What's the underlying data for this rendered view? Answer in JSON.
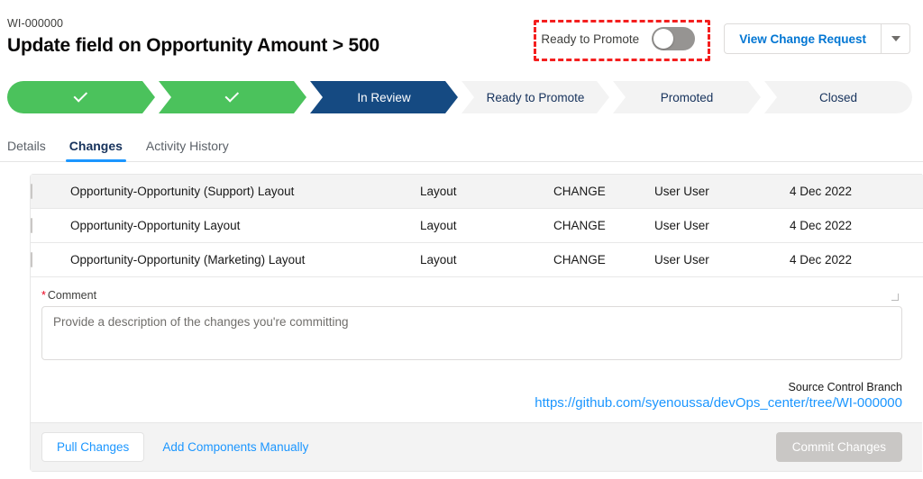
{
  "header": {
    "record_id": "WI-000000",
    "title": "Update field on Opportunity Amount > 500",
    "toggle_label": "Ready to Promote",
    "toggle_state": "off",
    "view_change_request_label": "View Change Request",
    "annotation_color": "#f41f1f"
  },
  "path": {
    "steps": [
      {
        "label": "",
        "state": "done"
      },
      {
        "label": "",
        "state": "done"
      },
      {
        "label": "In Review",
        "state": "current"
      },
      {
        "label": "Ready to Promote",
        "state": "upcoming"
      },
      {
        "label": "Promoted",
        "state": "upcoming"
      },
      {
        "label": "Closed",
        "state": "upcoming"
      }
    ],
    "done_color": "#4bc25c",
    "current_color": "#154a82",
    "upcoming_color": "#f3f3f3"
  },
  "tabs": [
    {
      "label": "Details",
      "active": false
    },
    {
      "label": "Changes",
      "active": true
    },
    {
      "label": "Activity History",
      "active": false
    }
  ],
  "table": {
    "rows": [
      {
        "name": "Opportunity-Opportunity (Support) Layout",
        "type": "Layout",
        "operation": "CHANGE",
        "user": "User User",
        "date": "4 Dec 2022",
        "checked": false,
        "selected": true
      },
      {
        "name": "Opportunity-Opportunity Layout",
        "type": "Layout",
        "operation": "CHANGE",
        "user": "User User",
        "date": "4 Dec 2022",
        "checked": false,
        "selected": false
      },
      {
        "name": "Opportunity-Opportunity (Marketing) Layout",
        "type": "Layout",
        "operation": "CHANGE",
        "user": "User User",
        "date": "4 Dec 2022",
        "checked": false,
        "selected": false
      }
    ]
  },
  "comment": {
    "required_marker": "*",
    "label": "Comment",
    "placeholder": "Provide a description of the changes you're committing",
    "value": ""
  },
  "branch": {
    "label": "Source Control Branch",
    "url": "https://github.com/syenoussa/devOps_center/tree/WI-000000"
  },
  "footer": {
    "pull_changes_label": "Pull Changes",
    "add_components_label": "Add Components Manually",
    "commit_label": "Commit Changes",
    "commit_disabled": true
  }
}
